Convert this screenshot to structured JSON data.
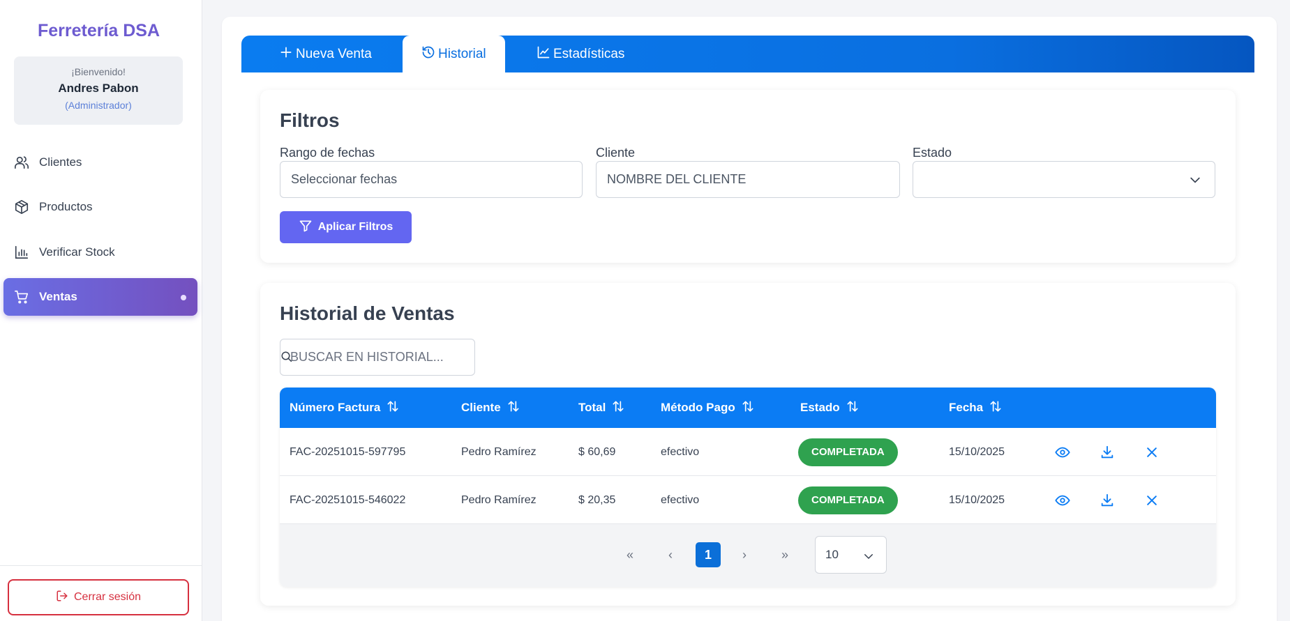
{
  "sidebar": {
    "brand": "Ferretería DSA",
    "welcome": "¡Bienvenido!",
    "user_name": "Andres Pabon",
    "user_role": "(Administrador)",
    "items": [
      {
        "label": "Clientes",
        "icon": "users-icon"
      },
      {
        "label": "Productos",
        "icon": "box-icon"
      },
      {
        "label": "Verificar Stock",
        "icon": "bar-chart-icon"
      },
      {
        "label": "Ventas",
        "icon": "cart-icon",
        "active": true
      }
    ],
    "logout_label": "Cerrar sesión"
  },
  "tabs": [
    {
      "label": "Nueva Venta",
      "icon": "plus-icon"
    },
    {
      "label": "Historial",
      "icon": "history-icon",
      "active": true
    },
    {
      "label": "Estadísticas",
      "icon": "chart-line-icon"
    }
  ],
  "filters": {
    "title": "Filtros",
    "date_label": "Rango de fechas",
    "date_placeholder": "Seleccionar fechas",
    "client_label": "Cliente",
    "client_placeholder": "NOMBRE DEL CLIENTE",
    "status_label": "Estado",
    "status_value": "",
    "apply_label": "Aplicar Filtros"
  },
  "history": {
    "title": "Historial de Ventas",
    "search_placeholder": "BUSCAR EN HISTORIAL...",
    "columns": [
      "Número Factura",
      "Cliente",
      "Total",
      "Método Pago",
      "Estado",
      "Fecha"
    ],
    "rows": [
      {
        "invoice": "FAC-20251015-597795",
        "client": "Pedro Ramírez",
        "total": "$ 60,69",
        "method": "efectivo",
        "status": "COMPLETADA",
        "date": "15/10/2025"
      },
      {
        "invoice": "FAC-20251015-546022",
        "client": "Pedro Ramírez",
        "total": "$ 20,35",
        "method": "efectivo",
        "status": "COMPLETADA",
        "date": "15/10/2025"
      }
    ],
    "pagination": {
      "first": "«",
      "prev": "‹",
      "current_page": "1",
      "next": "›",
      "last": "»",
      "page_size": "10"
    }
  },
  "colors": {
    "brand": "#6d5bd0",
    "primary_blue": "#0b7cf4",
    "active_nav": "#6a6ee4",
    "status_completed": "#2fa24f",
    "logout": "#d6303f"
  }
}
